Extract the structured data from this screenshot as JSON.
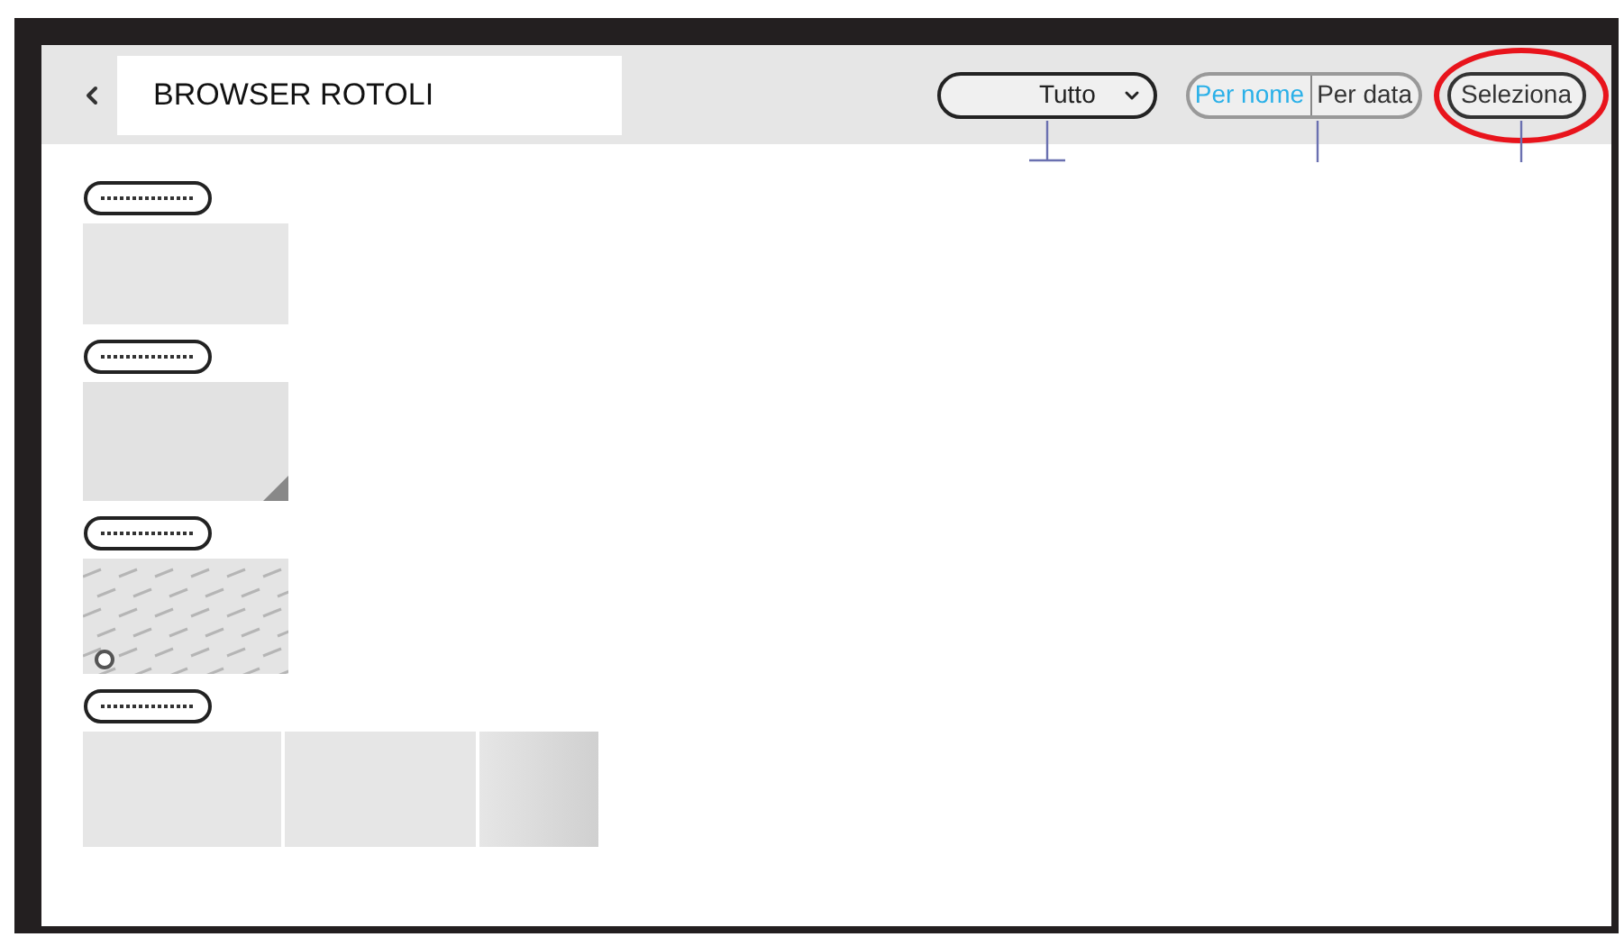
{
  "header": {
    "title": "BROWSER ROTOLI",
    "filter": {
      "value": "Tutto"
    },
    "sort": [
      {
        "label": "Per nome",
        "selected": true
      },
      {
        "label": "Per data",
        "selected": false
      }
    ],
    "select_button": {
      "label": "Seleziona",
      "highlighted": true
    }
  },
  "rolls": [
    {
      "kind": "plain"
    },
    {
      "kind": "textured"
    },
    {
      "kind": "patterned"
    },
    {
      "kind": "segmented"
    }
  ]
}
